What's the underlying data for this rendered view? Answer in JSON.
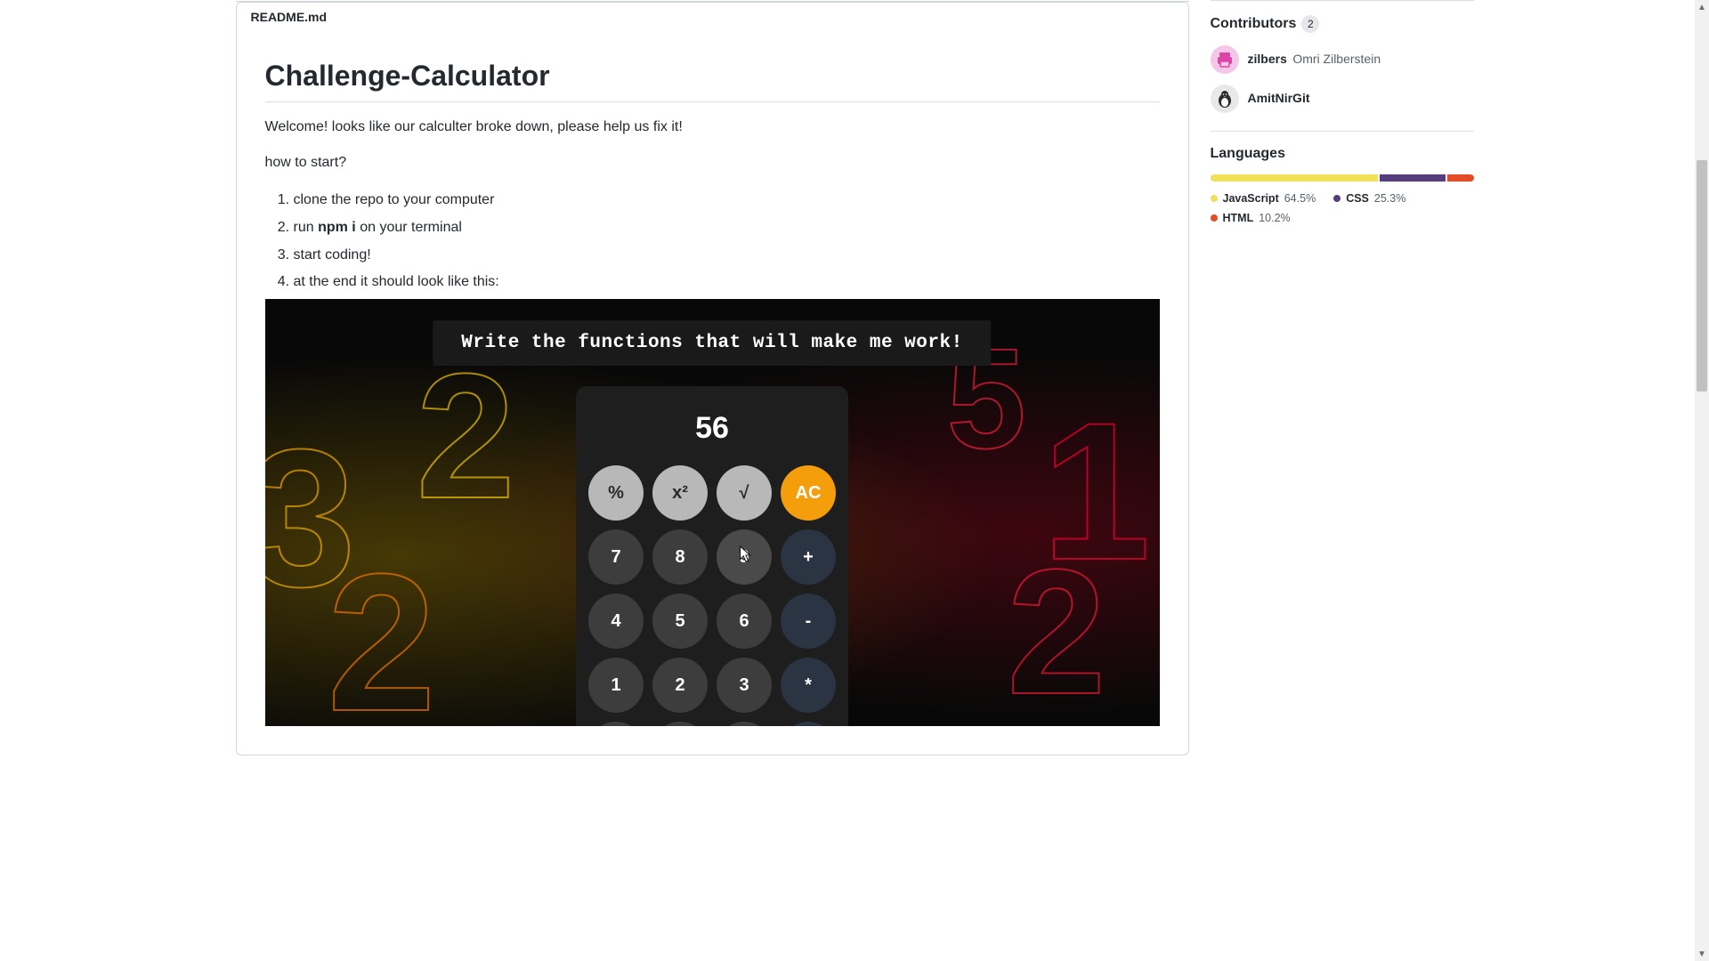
{
  "readme": {
    "filename": "README.md",
    "title": "Challenge-Calculator",
    "intro": "Welcome! looks like our calculter broke down, please help us fix it!",
    "how_to": "how to start?",
    "steps": {
      "s1": "clone the repo to your computer",
      "s2_pre": "run ",
      "s2_code": "npm i",
      "s2_post": " on your terminal",
      "s3": "start coding!",
      "s4": "at the end it should look like this:"
    },
    "calc": {
      "banner": "Write the functions that will make me work!",
      "display": "56",
      "buttons": {
        "percent": "%",
        "square": "x²",
        "sqrt": "√",
        "ac": "AC",
        "7": "7",
        "8": "8",
        "9": "9",
        "plus": "+",
        "4": "4",
        "5": "5",
        "6": "6",
        "minus": "-",
        "1": "1",
        "2": "2",
        "3": "3",
        "mult": "*"
      }
    }
  },
  "sidebar": {
    "contributors": {
      "title": "Contributors",
      "count": "2",
      "items": [
        {
          "username": "zilbers",
          "realname": "Omri Zilberstein"
        },
        {
          "username": "AmitNirGit",
          "realname": ""
        }
      ]
    },
    "languages": {
      "title": "Languages",
      "items": [
        {
          "name": "JavaScript",
          "pct": "64.5%",
          "color": "#f1e05a"
        },
        {
          "name": "CSS",
          "pct": "25.3%",
          "color": "#563d7c"
        },
        {
          "name": "HTML",
          "pct": "10.2%",
          "color": "#e34c26"
        }
      ]
    }
  }
}
